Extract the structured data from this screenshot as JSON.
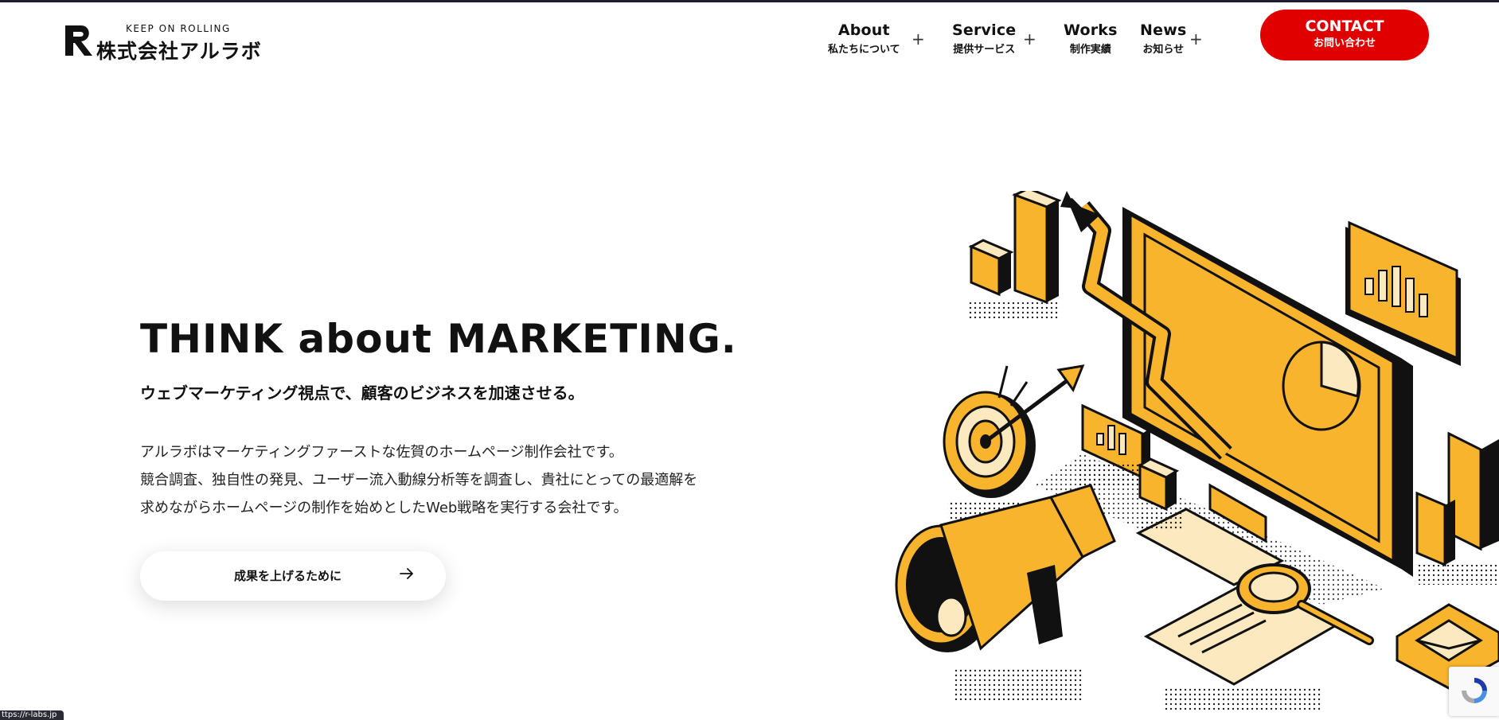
{
  "brand": {
    "tagline": "KEEP ON ROLLING",
    "name": "株式会社アルラボ"
  },
  "nav": {
    "items": [
      {
        "en": "About",
        "ja": "私たちについて",
        "has_submenu": true
      },
      {
        "en": "Service",
        "ja": "提供サービス",
        "has_submenu": true
      },
      {
        "en": "Works",
        "ja": "制作実績",
        "has_submenu": false
      },
      {
        "en": "News",
        "ja": "お知らせ",
        "has_submenu": true
      }
    ],
    "plus_symbol": "+",
    "contact": {
      "en": "CONTACT",
      "ja": "お問い合わせ"
    }
  },
  "hero": {
    "title": "THINK about MARKETING.",
    "subtitle": "ウェブマーケティング視点で、顧客のビジネスを加速させる。",
    "body": [
      "アルラボはマーケティングファーストな佐賀のホームページ制作会社です。",
      "競合調査、独自性の発見、ユーザー流入動線分析等を調査し、貴社にとっての最適解を",
      "求めながらホームページの制作を始めとしたWeb戦略を実行する会社です。"
    ],
    "cta_label": "成果を上げるために"
  },
  "status_bar": {
    "url": "ttps://r-labs.jp"
  },
  "colors": {
    "accent_red": "#e00000",
    "illustration_yellow": "#f9b42d",
    "illustration_cream": "#fde9c0",
    "ink": "#111111"
  },
  "icons": {
    "cta_arrow": "arrow-right-icon",
    "recaptcha": "recaptcha-icon"
  }
}
